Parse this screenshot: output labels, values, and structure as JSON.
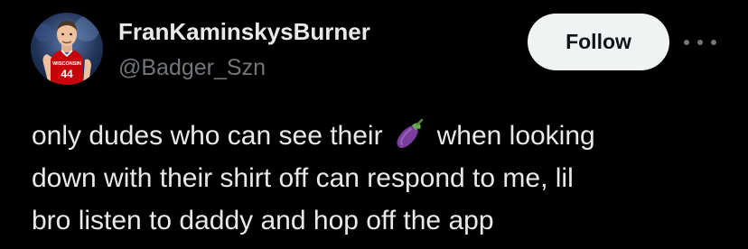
{
  "author": {
    "display_name": "FranKaminskysBurner",
    "handle": "@Badger_Szn",
    "avatar": {
      "icon": "basketball-player-avatar",
      "jersey_text": "WISCONSIN",
      "jersey_number": "44"
    }
  },
  "actions": {
    "follow_label": "Follow",
    "more_icon": "more-horizontal-icon"
  },
  "tweet": {
    "line1_before_emoji": "only dudes who can see their",
    "emoji_icon": "eggplant-emoji-icon",
    "line1_after_emoji": "when looking",
    "line2": "down with their shirt off can respond to me, lil",
    "line3": "bro listen to daddy and hop off the app"
  },
  "colors": {
    "background": "#000000",
    "primary_text": "#e7e9ea",
    "secondary_text": "#71767b",
    "follow_button_bg": "#eff3f4",
    "follow_button_text": "#0f1419",
    "jersey_red": "#c5050c"
  }
}
